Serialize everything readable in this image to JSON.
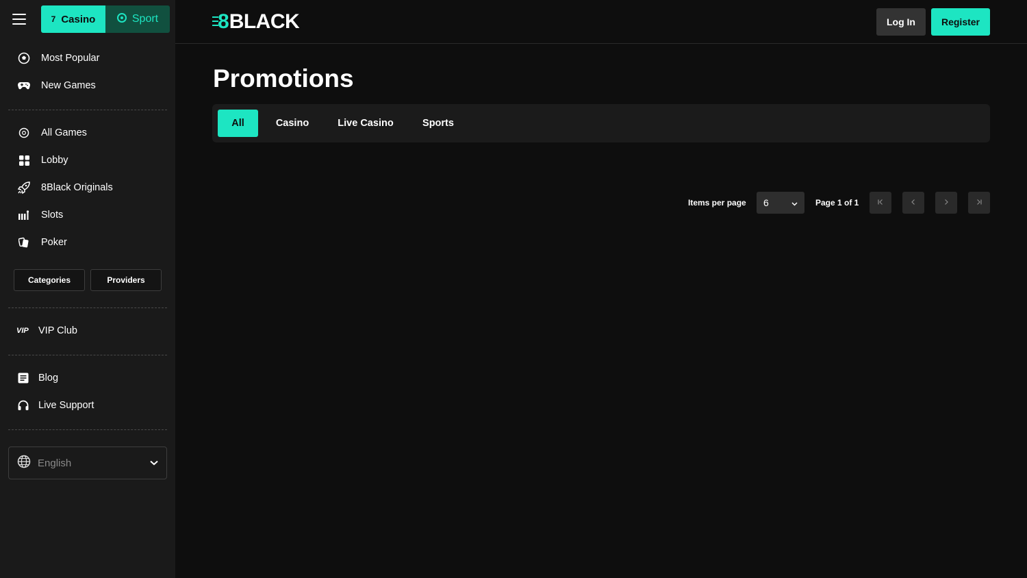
{
  "sidebar": {
    "mode_switch": {
      "casino_label": "Casino",
      "sport_label": "Sport"
    },
    "group1": [
      {
        "label": "Most Popular",
        "icon": "soccer-ball-icon"
      },
      {
        "label": "New Games",
        "icon": "gamepad-icon"
      }
    ],
    "group2": [
      {
        "label": "All Games",
        "icon": "all-games-icon"
      },
      {
        "label": "Lobby",
        "icon": "grid-icon"
      },
      {
        "label": "8Black Originals",
        "icon": "rocket-icon"
      },
      {
        "label": "Slots",
        "icon": "slots-icon"
      },
      {
        "label": "Poker",
        "icon": "poker-icon"
      }
    ],
    "filter_buttons": {
      "categories_label": "Categories",
      "providers_label": "Providers"
    },
    "vip": {
      "label": "VIP Club",
      "icon_text": "VIP"
    },
    "group3": [
      {
        "label": "Blog",
        "icon": "blog-icon"
      },
      {
        "label": "Live Support",
        "icon": "headset-icon"
      }
    ],
    "language": {
      "selected": "English"
    }
  },
  "header": {
    "logo_digit": "8",
    "logo_word": "BLACK",
    "login_label": "Log In",
    "register_label": "Register"
  },
  "main": {
    "title": "Promotions",
    "tabs": [
      {
        "label": "All",
        "active": true
      },
      {
        "label": "Casino",
        "active": false
      },
      {
        "label": "Live Casino",
        "active": false
      },
      {
        "label": "Sports",
        "active": false
      }
    ],
    "pagination": {
      "items_per_page_label": "Items per page",
      "items_per_page_value": "6",
      "page_label": "Page 1 of 1"
    }
  },
  "colors": {
    "accent": "#1de5c2",
    "sport_bg": "#11503f",
    "sidebar_bg": "#1a1a1a",
    "page_bg": "#0e0e0e"
  }
}
